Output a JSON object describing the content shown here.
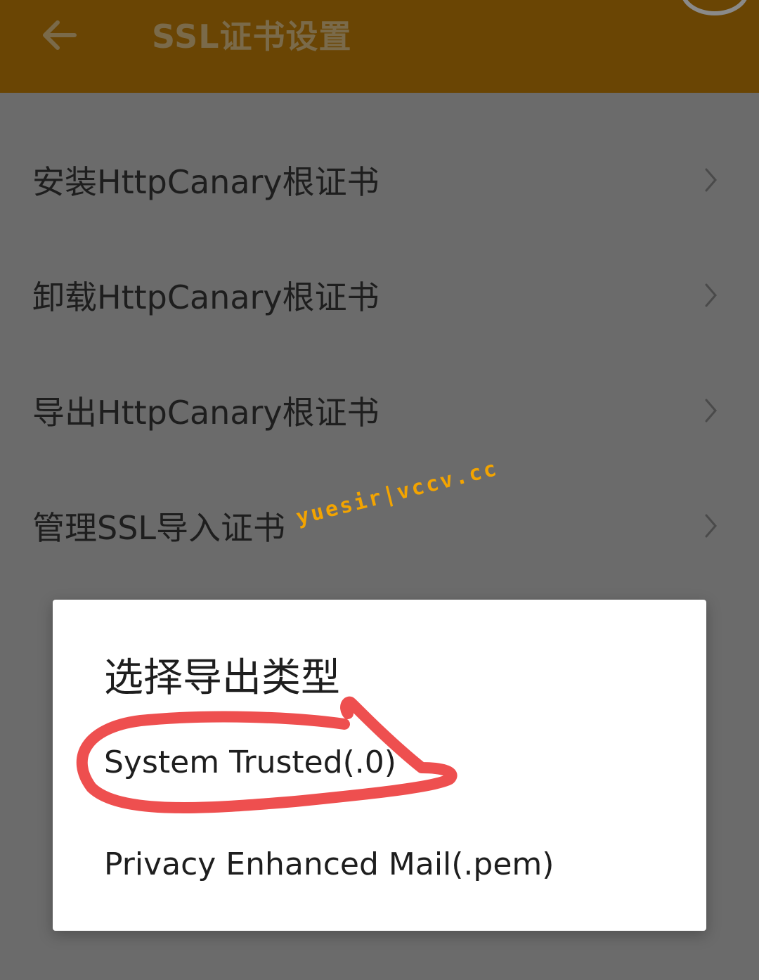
{
  "app": {
    "title": "SSL证书设置",
    "colors": {
      "toolbar": "#6a4504",
      "scrim": "#6b6b6b",
      "dialog": "#ffffff",
      "annotation": "#ee4f4f",
      "watermark": "#f3a400"
    }
  },
  "toolbar": {
    "back_icon": "arrow-left-icon",
    "title": "SSL证书设置"
  },
  "menu": {
    "items": [
      {
        "label": "安装HttpCanary根证书",
        "icon": "chevron-right-icon"
      },
      {
        "label": "卸载HttpCanary根证书",
        "icon": "chevron-right-icon"
      },
      {
        "label": "导出HttpCanary根证书",
        "icon": "chevron-right-icon"
      },
      {
        "label": "管理SSL导入证书",
        "icon": "chevron-right-icon"
      }
    ]
  },
  "watermark": {
    "text": "yuesir|vccv.cc"
  },
  "dialog": {
    "title": "选择导出类型",
    "options": [
      {
        "label": "System Trusted(.0)",
        "highlighted": true
      },
      {
        "label": "Privacy Enhanced Mail(.pem)",
        "highlighted": false
      }
    ]
  }
}
